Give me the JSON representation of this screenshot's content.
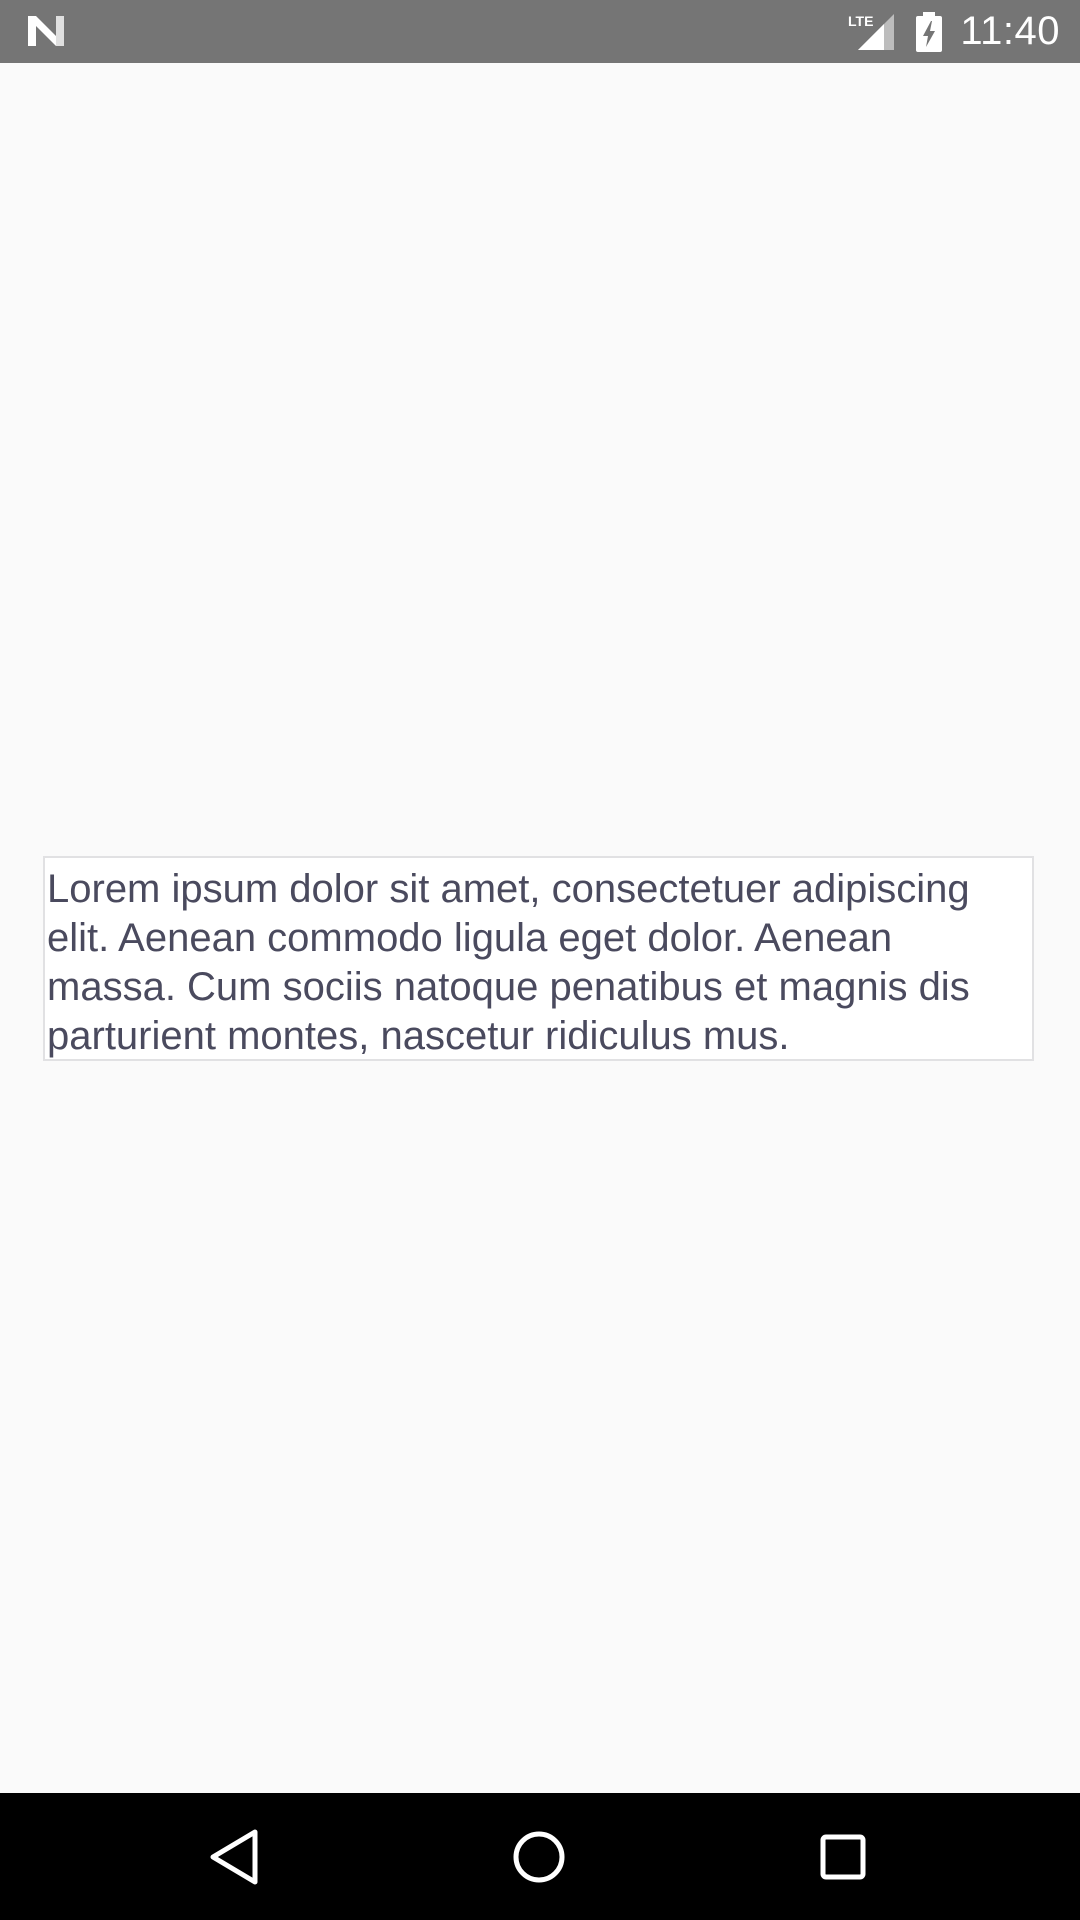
{
  "status_bar": {
    "time": "11:40",
    "network_label": "LTE",
    "icons": [
      "notification-n-icon",
      "lte-signal-icon",
      "battery-charging-icon"
    ],
    "background": "#757575"
  },
  "main": {
    "text_box": {
      "content": "Lorem ipsum dolor sit amet, consectetuer adipiscing elit. Aenean commodo ligula eget dolor. Aenean massa. Cum sociis natoque penatibus et magnis dis parturient montes, nascetur ridiculus mus.",
      "text_color": "#4a4a5e",
      "border_color": "#e1e1e3"
    },
    "background": "#fafafa"
  },
  "nav_bar": {
    "buttons": [
      "back-icon",
      "home-icon",
      "recents-icon"
    ],
    "background": "#000000"
  }
}
